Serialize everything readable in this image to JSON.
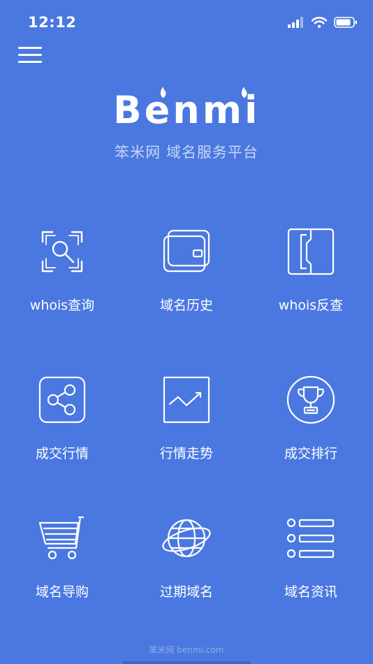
{
  "status_bar": {
    "time": "12:12"
  },
  "header": {
    "logo_text": "Benmi",
    "subtitle": "笨米网 域名服务平台"
  },
  "menu": {
    "icon": "hamburger-menu-icon"
  },
  "tiles": [
    {
      "label": "whois查询",
      "icon": "whois-search-icon"
    },
    {
      "label": "域名历史",
      "icon": "wallet-history-icon"
    },
    {
      "label": "whois反查",
      "icon": "reverse-bracket-icon"
    },
    {
      "label": "成交行情",
      "icon": "share-network-icon"
    },
    {
      "label": "行情走势",
      "icon": "trend-chart-icon"
    },
    {
      "label": "成交排行",
      "icon": "trophy-icon"
    },
    {
      "label": "域名导购",
      "icon": "shopping-cart-icon"
    },
    {
      "label": "过期域名",
      "icon": "globe-orbit-icon"
    },
    {
      "label": "域名资讯",
      "icon": "list-icon"
    }
  ],
  "footer": {
    "text": "笨米网 benmi.com"
  },
  "colors": {
    "background": "#4a78e0",
    "foreground": "#ffffff",
    "subtitle": "#c7d5f6"
  }
}
